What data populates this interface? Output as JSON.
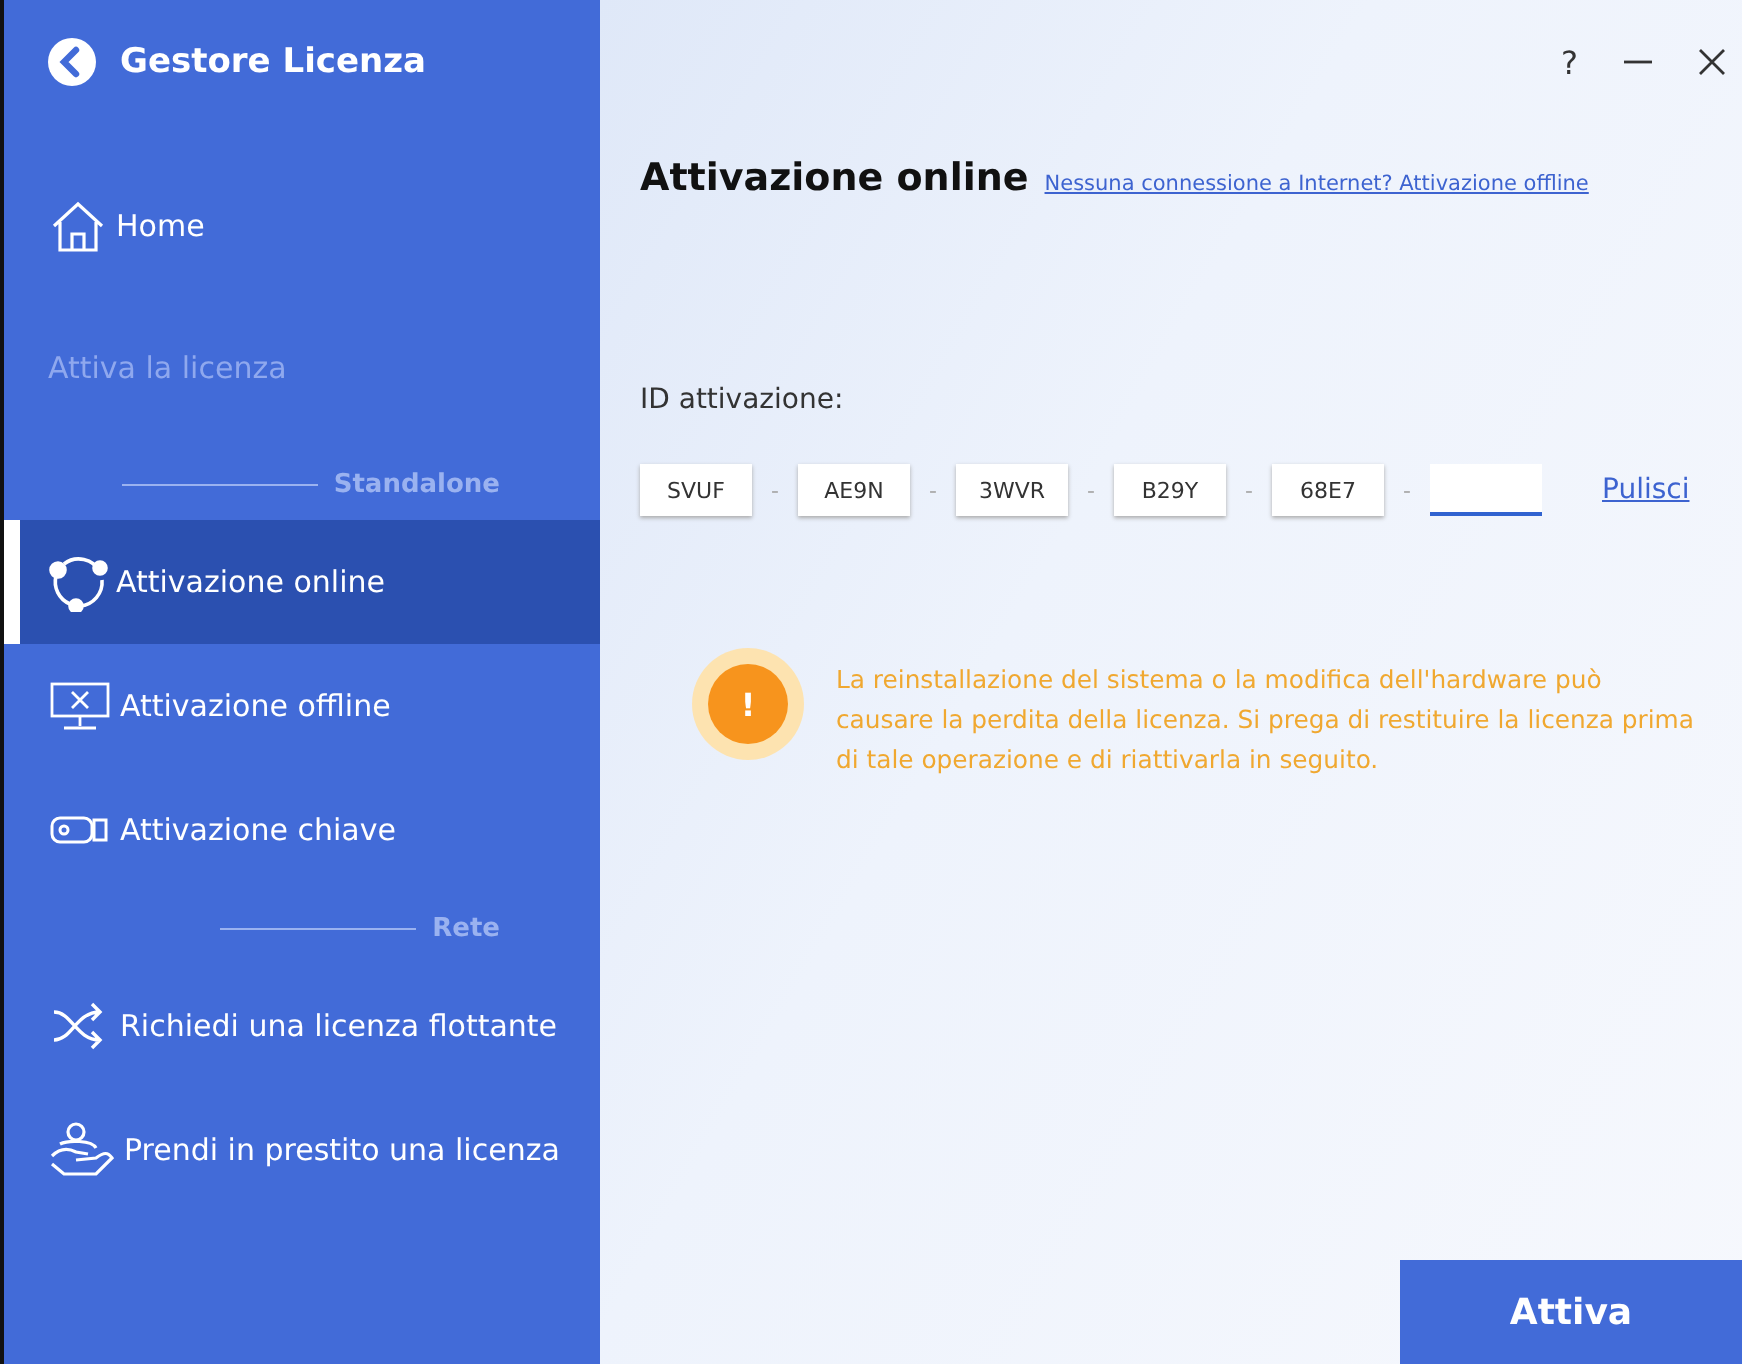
{
  "app": {
    "title": "Gestore Licenza"
  },
  "sidebar": {
    "items": [
      {
        "kind": "item",
        "label": "Home",
        "selected": false
      },
      {
        "kind": "heading",
        "label": "Attiva la licenza"
      },
      {
        "kind": "group",
        "label": "Standalone"
      },
      {
        "kind": "item",
        "label": "Attivazione online",
        "selected": true
      },
      {
        "kind": "item",
        "label": "Attivazione offline",
        "selected": false
      },
      {
        "kind": "item",
        "label": "Attivazione chiave",
        "selected": false
      },
      {
        "kind": "group",
        "label": "Rete"
      },
      {
        "kind": "item",
        "label": "Richiedi una licenza flottante",
        "selected": false
      },
      {
        "kind": "item",
        "label": "Prendi in prestito una licenza",
        "selected": false
      }
    ]
  },
  "window_controls": {
    "help": "?"
  },
  "main": {
    "title": "Attivazione online",
    "link": "Nessuna connessione a Internet? Attivazione offline",
    "id_label": "ID attivazione:",
    "segments": [
      {
        "value": "SVUF",
        "focused": false
      },
      {
        "value": "AE9N",
        "focused": false
      },
      {
        "value": "3WVR",
        "focused": false
      },
      {
        "value": "B29Y",
        "focused": false
      },
      {
        "value": "68E7",
        "focused": false
      },
      {
        "focused": true
      }
    ],
    "separator": "-",
    "clear_link": "Pulisci",
    "warning": {
      "icon_text": "!",
      "text": "La reinstallazione del sistema o la modifica dell'hardware può causare la perdita della licenza. Si prega di restituire la licenza prima di tale operazione e di riattivarla in seguito."
    },
    "activate_button": "Attiva"
  }
}
